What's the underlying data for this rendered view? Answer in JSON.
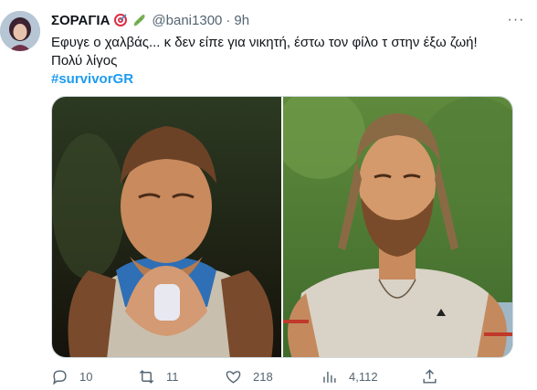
{
  "tweet": {
    "display_name": "ΣΟΡΑΓΙΑ",
    "emojis": [
      "direct-hit-emoji",
      "cucumber-emoji"
    ],
    "handle": "@bani1300",
    "separator": "·",
    "time": "9h",
    "text_line1": "Εφυγε ο χαλβάς... κ δεν είπε για νικητή, έστω τον φίλο τ στην έξω ζωή!",
    "text_line2": "Πολύ λίγος",
    "hashtag": "#survivorGR",
    "more_label": "···"
  },
  "actions": {
    "reply_count": "10",
    "retweet_count": "11",
    "like_count": "218",
    "views_count": "4,112"
  },
  "colors": {
    "accent": "#1d9bf0",
    "secondary_text": "#536471",
    "border": "#cfd9de"
  }
}
